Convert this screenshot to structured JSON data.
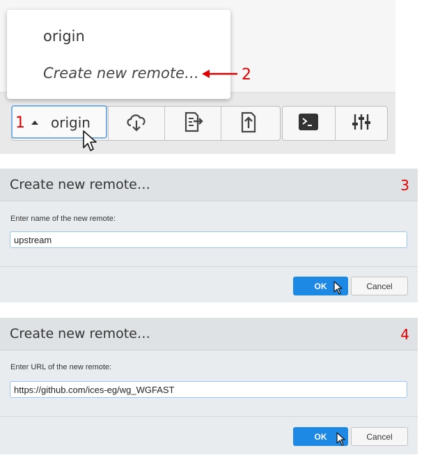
{
  "remote_menu": {
    "items": [
      "origin",
      "Create new remote…"
    ]
  },
  "toolbar": {
    "remote_button_label": "origin",
    "icons": [
      "cloud-download-icon",
      "fetch-icon",
      "push-icon",
      "terminal-icon",
      "settings-sliders-icon"
    ]
  },
  "callouts": {
    "step1": "1",
    "step2": "2"
  },
  "dialog_name": {
    "title": "Create new remote…",
    "step": "3",
    "prompt": "Enter name of the new remote:",
    "value": "upstream",
    "ok_label": "OK",
    "cancel_label": "Cancel"
  },
  "dialog_url": {
    "title": "Create new remote…",
    "step": "4",
    "prompt": "Enter URL of the new remote:",
    "value": "https://github.com/ices-eg/wg_WGFAST",
    "ok_label": "OK",
    "cancel_label": "Cancel"
  },
  "colors": {
    "accent": "#1e88e5",
    "callout": "#e00000",
    "focus_border": "#79aee5"
  }
}
